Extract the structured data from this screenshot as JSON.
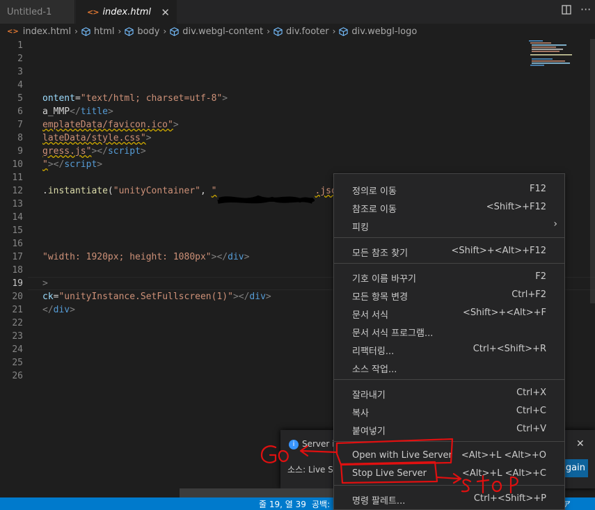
{
  "tabs": [
    {
      "label": "Untitled-1"
    },
    {
      "label": "index.html"
    }
  ],
  "breadcrumb": [
    "index.html",
    "html",
    "body",
    "div.webgl-content",
    "div.footer",
    "div.webgl-logo"
  ],
  "lines": [
    {
      "n": "1"
    },
    {
      "n": "2"
    },
    {
      "n": "3"
    },
    {
      "n": "4"
    },
    {
      "n": "5"
    },
    {
      "n": "6"
    },
    {
      "n": "7"
    },
    {
      "n": "8"
    },
    {
      "n": "9"
    },
    {
      "n": "10"
    },
    {
      "n": "11"
    },
    {
      "n": "12"
    },
    {
      "n": "13"
    },
    {
      "n": "14"
    },
    {
      "n": "15"
    },
    {
      "n": "16"
    },
    {
      "n": "17"
    },
    {
      "n": "18"
    },
    {
      "n": "19"
    },
    {
      "n": "20"
    },
    {
      "n": "21"
    },
    {
      "n": "22"
    },
    {
      "n": "23"
    },
    {
      "n": "24"
    },
    {
      "n": "25"
    },
    {
      "n": "26"
    }
  ],
  "code": {
    "l5": {
      "a": "ontent",
      "b": "=",
      "c": "\"text/html; charset=utf-8\"",
      "d": ">"
    },
    "l6": {
      "a": "a_MMP",
      "b": "</",
      "c": "title",
      "d": ">"
    },
    "l7": {
      "a": "emplateData/favicon.ico\"",
      "b": ">"
    },
    "l8": {
      "a": "lateData/style.css\"",
      "b": ">"
    },
    "l9": {
      "a": "gress.js\"",
      "b": "></",
      "c": "script",
      "d": ">"
    },
    "l10": {
      "a": "\"",
      "b": "></",
      "c": "script",
      "d": ">"
    },
    "l12": {
      "a": ".",
      "b": "instantiate",
      "c": "(",
      "d": "\"unityContainer\"",
      "e": ", ",
      "f": "\"",
      "g": ".json\""
    },
    "l17": {
      "a": "\"width: 1920px; height: 1080px\"",
      "b": "></",
      "c": "div",
      "d": ">"
    },
    "l19": {
      "a": ">"
    },
    "l20": {
      "a": "ck",
      "b": "=",
      "c": "\"unityInstance.SetFullscreen(1)\"",
      "d": "></",
      "e": "div",
      "f": ">"
    },
    "l21": {
      "a": "</",
      "b": "div",
      "c": ">"
    }
  },
  "context_menu": {
    "groups": [
      [
        {
          "label": "정의로 이동",
          "shortcut": "F12"
        },
        {
          "label": "참조로 이동",
          "shortcut": "<Shift>+F12"
        },
        {
          "label": "피킹",
          "shortcut": ""
        }
      ],
      [
        {
          "label": "모든 참조 찾기",
          "shortcut": "<Shift>+<Alt>+F12"
        }
      ],
      [
        {
          "label": "기호 이름 바꾸기",
          "shortcut": "F2"
        },
        {
          "label": "모든 항목 변경",
          "shortcut": "Ctrl+F2"
        },
        {
          "label": "문서 서식",
          "shortcut": "<Shift>+<Alt>+F"
        },
        {
          "label": "문서 서식 프로그램...",
          "shortcut": ""
        },
        {
          "label": "리팩터링...",
          "shortcut": "Ctrl+<Shift>+R"
        },
        {
          "label": "소스 작업...",
          "shortcut": ""
        }
      ],
      [
        {
          "label": "잘라내기",
          "shortcut": "Ctrl+X"
        },
        {
          "label": "복사",
          "shortcut": "Ctrl+C"
        },
        {
          "label": "붙여넣기",
          "shortcut": "Ctrl+V"
        }
      ],
      [
        {
          "label": "Open with Live Server",
          "shortcut": "<Alt>+L <Alt>+O"
        },
        {
          "label": "Stop Live Server",
          "shortcut": "<Alt>+L <Alt>+C"
        }
      ],
      [
        {
          "label": "명령 팔레트...",
          "shortcut": "Ctrl+<Shift>+P"
        }
      ]
    ]
  },
  "notification": {
    "message": "Server is",
    "source": "소스: Live Se",
    "button": "gain"
  },
  "statusbar": {
    "position": "줄 19, 열 39",
    "spaces": "공백:",
    "right": "ア"
  },
  "annotations": {
    "go": "Go",
    "stop": "stop",
    "color": "#e01010"
  }
}
